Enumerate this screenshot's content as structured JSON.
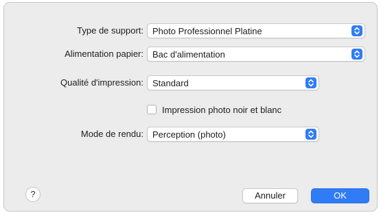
{
  "dialog": {
    "media_type": {
      "label": "Type de support:",
      "value": "Photo Professionnel Platine"
    },
    "paper_source": {
      "label": "Alimentation papier:",
      "value": "Bac d'alimentation"
    },
    "print_quality": {
      "label": "Qualité d'impression:",
      "value": "Standard"
    },
    "bw_photo": {
      "label": "Impression photo noir et blanc",
      "checked": false
    },
    "rendering_intent": {
      "label": "Mode de rendu:",
      "value": "Perception (photo)"
    }
  },
  "footer": {
    "help_label": "?",
    "cancel_label": "Annuler",
    "ok_label": "OK"
  },
  "colors": {
    "accent": "#2f7cf6",
    "dialog_background": "#ececec"
  },
  "icons": {
    "popup_stepper": "chevron-up-down-icon",
    "help": "help-icon"
  }
}
